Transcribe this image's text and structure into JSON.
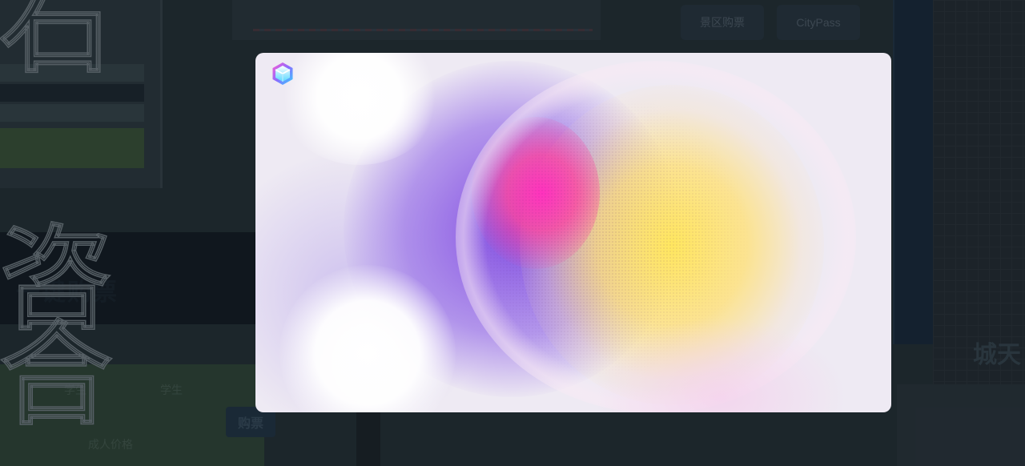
{
  "background_app": {
    "outline_glyphs": [
      "石",
      "咨",
      "合"
    ],
    "section_title": "一键购票",
    "nav_buttons": [
      "景区购票",
      "CityPass"
    ],
    "lower_labels": [
      "学生",
      "学生",
      "成人价格"
    ],
    "buy_button": "购票",
    "right_text": "城天"
  },
  "modal": {
    "logo_icon": "hexagon-cube-logo",
    "colors": {
      "violet": "#7d46e1",
      "pink": "#ff32be",
      "yellow": "#ffe65f",
      "base": "#eeeaf3"
    }
  }
}
